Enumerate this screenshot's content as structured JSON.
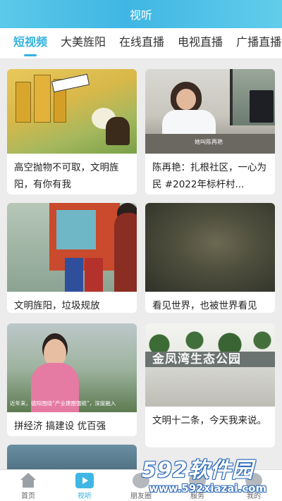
{
  "header": {
    "title": "视听"
  },
  "tabs": [
    {
      "label": "短视频",
      "active": true
    },
    {
      "label": "大美旌阳",
      "active": false
    },
    {
      "label": "在线直播",
      "active": false
    },
    {
      "label": "电视直播",
      "active": false
    },
    {
      "label": "广播直播",
      "active": false
    }
  ],
  "videos": [
    {
      "title": "高空抛物不可取，文明旌阳，有你有我"
    },
    {
      "title": "陈再艳：扎根社区，一心为民 #2022年标杆村...",
      "thumb_caption": "她叫陈再艳"
    },
    {
      "title": "文明旌阳，垃圾规放"
    },
    {
      "title": "看见世界，也被世界看见"
    },
    {
      "title": "拼经济 搞建设 优百强",
      "thumb_caption": "近年来，德阳围绕“产业建圈强链”，深度融入"
    },
    {
      "title": "文明十二条，今天我来说。",
      "thumb_text": "金凤湾生态公园"
    }
  ],
  "bottom_nav": [
    {
      "label": "首页",
      "icon": "home-icon",
      "active": false
    },
    {
      "label": "视听",
      "icon": "tv-play-icon",
      "active": true
    },
    {
      "label": "朋友圈",
      "icon": "friends-icon",
      "active": false
    },
    {
      "label": "服务",
      "icon": "service-icon",
      "active": false
    },
    {
      "label": "我的",
      "icon": "profile-icon",
      "active": false
    }
  ],
  "watermark": {
    "brand": "592软件园",
    "url": "www.592xiazai.com"
  },
  "colors": {
    "accent": "#32b2e0",
    "header_gradient_start": "#5cc9e8",
    "background": "#ececec"
  }
}
